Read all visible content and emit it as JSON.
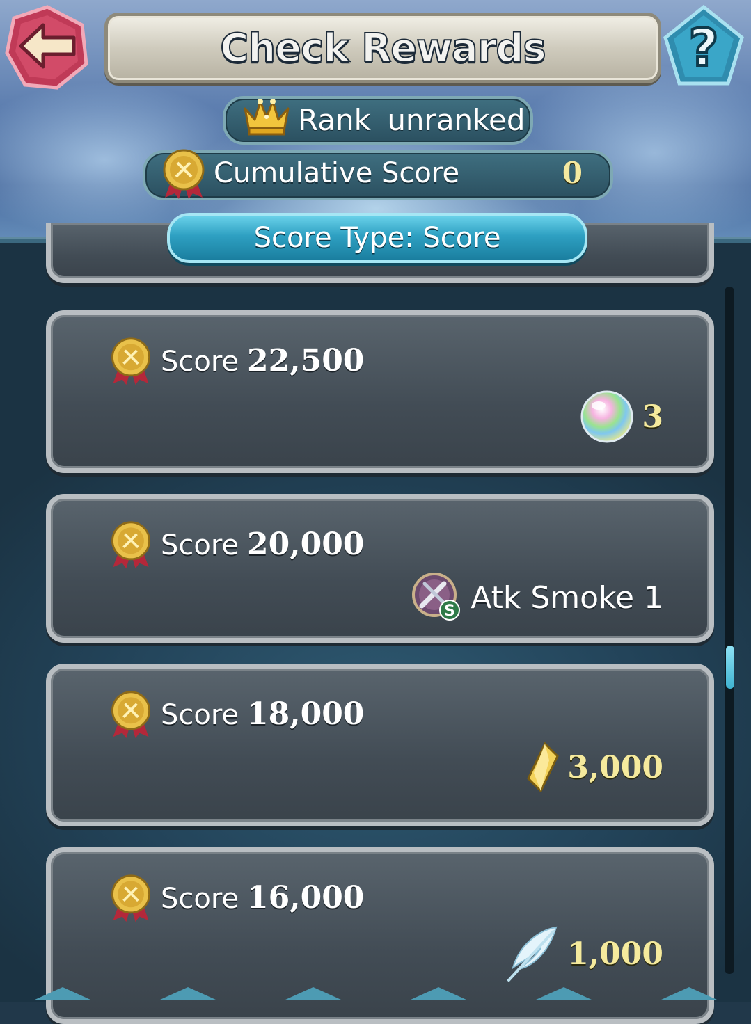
{
  "header": {
    "title": "Check Rewards",
    "back_icon": "back-arrow-icon",
    "help_label": "?"
  },
  "rank": {
    "label": "Rank",
    "value": "unranked",
    "icon": "crown-icon"
  },
  "cumulative": {
    "label": "Cumulative Score",
    "value": "0",
    "icon": "medal-icon"
  },
  "score_type": {
    "label": "Score Type: Score"
  },
  "rewards": [
    {
      "score_label": "Score",
      "score_value": "22,500",
      "reward_icon": "orb-icon",
      "reward_amount": "3"
    },
    {
      "score_label": "Score",
      "score_value": "20,000",
      "reward_icon": "skill-icon",
      "skill_badge": "S",
      "reward_name": "Atk Smoke 1"
    },
    {
      "score_label": "Score",
      "score_value": "18,000",
      "reward_icon": "crystal-icon",
      "reward_amount": "3,000"
    },
    {
      "score_label": "Score",
      "score_value": "16,000",
      "reward_icon": "feather-icon",
      "reward_amount": "1,000"
    }
  ],
  "colors": {
    "accent": "#2ea0c2",
    "gold_text": "#f5ea9d",
    "card_bg": "#4a545d"
  },
  "scroll_position": 0.52
}
